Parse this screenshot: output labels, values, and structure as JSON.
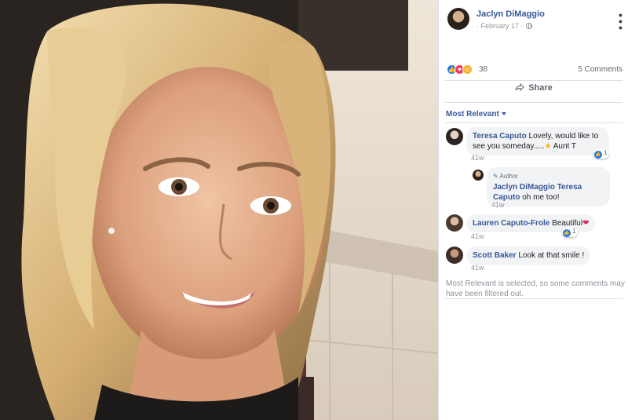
{
  "post": {
    "author": "Jaclyn DiMaggio",
    "date": "· February 17 ·",
    "more_icon": "more-icon",
    "reaction_count": "38",
    "comments_count": "5 Comments",
    "share_label": "Share",
    "sort_label": "Most Relevant"
  },
  "comments": [
    {
      "name": "Teresa Caputo",
      "text": " Lovely, would like to see you someday.....",
      "text_suffix": " Aunt T",
      "time": "41w",
      "reaction_count": "1"
    },
    {
      "author_badge": "Author",
      "name": "Jaclyn DiMaggio",
      "tag": "Teresa Caputo",
      "text": " oh me too!",
      "time": "41w"
    },
    {
      "name": "Lauren Caputo-Frole",
      "text": " Beautiful",
      "time": "41w",
      "reaction_count": "1"
    },
    {
      "name": "Scott Baker",
      "text": " Look at that smile !",
      "time": "41w"
    }
  ],
  "filter_note": "Most Relevant is selected, so some comments may have been filtered out.",
  "colors": {
    "link": "#385898",
    "like": "#1877f2",
    "love": "#f33e58",
    "wow": "#f7b125"
  }
}
